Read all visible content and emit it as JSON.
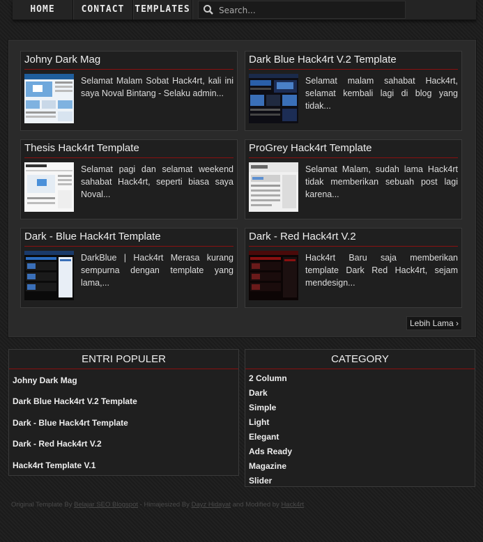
{
  "nav": {
    "home": "HOME",
    "contact": "CONTACT",
    "templates": "TEMPLATES",
    "search_placeholder": "Search..."
  },
  "posts": [
    {
      "title": "Johny Dark Mag",
      "snippet": "Selamat Malam Sobat Hack4rt, kali ini saya Noval Bintang - Selaku admin...",
      "thumb": "light-blue"
    },
    {
      "title": "Dark Blue Hack4rt V.2 Template",
      "snippet": "Selamat malam sahabat Hack4rt, selamat kembali lagi di blog yang tidak...",
      "thumb": "dark-blue"
    },
    {
      "title": "Thesis Hack4rt Template",
      "snippet": "Selamat pagi dan selamat weekend sahabat Hack4rt, seperti biasa saya Noval...",
      "thumb": "light"
    },
    {
      "title": "ProGrey Hack4rt Template",
      "snippet": "Selamat Malam, sudah lama Hack4rt tidak memberikan sebuah post lagi karena...",
      "thumb": "grey"
    },
    {
      "title": "Dark - Blue Hack4rt Template",
      "snippet": "DarkBlue | Hack4rt Merasa kurang sempurna dengan template yang lama,...",
      "thumb": "dark-blue-2"
    },
    {
      "title": "Dark - Red Hack4rt V.2",
      "snippet": "Hack4rt Baru saja memberikan template Dark Red Hack4rt, sejam mendesign...",
      "thumb": "dark-red"
    }
  ],
  "more_label": "Lebih Lama ›",
  "popular": {
    "title": "ENTRI POPULER",
    "items": [
      "Johny Dark Mag",
      "Dark Blue Hack4rt V.2 Template",
      "Dark - Blue Hack4rt Template",
      "Dark - Red Hack4rt V.2",
      "Hack4rt Template V.1"
    ]
  },
  "category": {
    "title": "CATEGORY",
    "items": [
      "2 Column",
      "Dark",
      "Simple",
      "Light",
      "Elegant",
      "Ads Ready",
      "Magazine",
      "Slider"
    ]
  },
  "footer": {
    "prefix": "Original Template By ",
    "link1": "Belajar SEO Blogspot",
    "mid": " - Himajesized By ",
    "link2": "Dayz Hidayat",
    "mid2": " and Modified by ",
    "link3": "Hack4rt"
  },
  "colors": {
    "accent": "#8a1010",
    "background": "#1c1c1c",
    "panel": "#1f1f1f"
  }
}
